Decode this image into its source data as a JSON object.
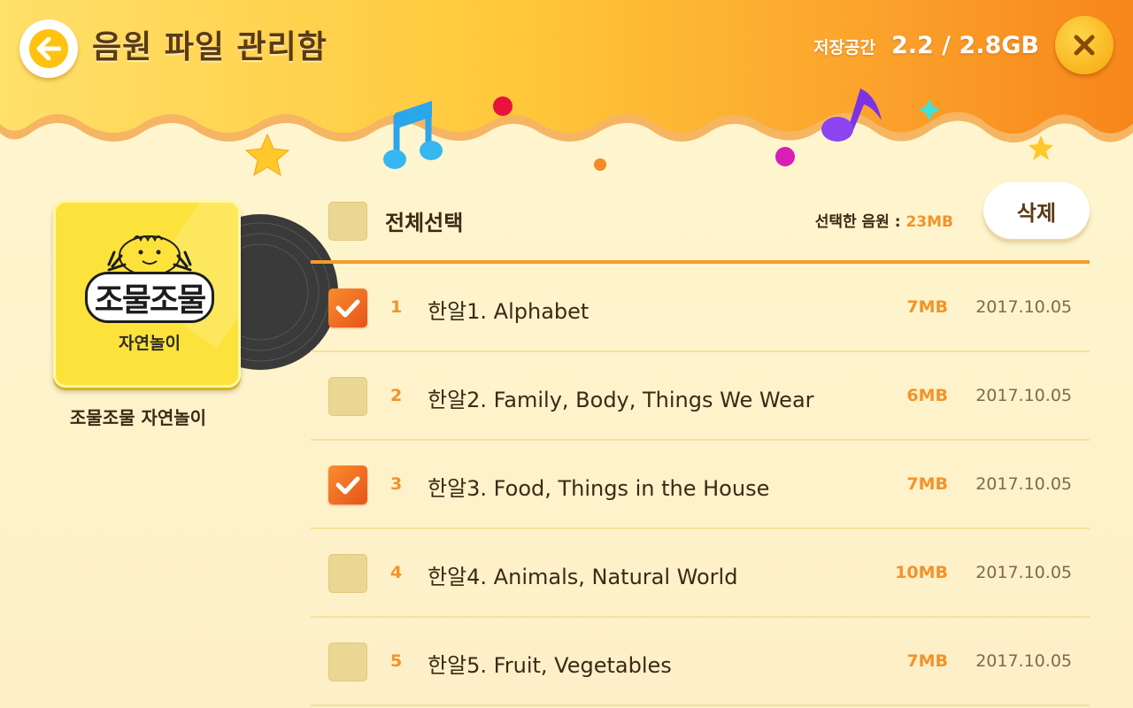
{
  "header": {
    "title": "음원 파일 관리함",
    "storage_label": "저장공간",
    "storage_value": "2.2 / 2.8GB"
  },
  "icons": {
    "back": "arrow-left-icon",
    "close": "close-icon",
    "check": "checkmark-icon"
  },
  "colors": {
    "accent": "#f3932a",
    "header_orange": "#f7931e",
    "header_yellow": "#ffd84e",
    "checked": "#e8531a"
  },
  "album": {
    "logo_title": "조물조물",
    "logo_sub": "자연놀이",
    "name": "조물조물 자연놀이"
  },
  "list": {
    "select_all_label": "전체선택",
    "selected_label": "선택한 음원 : ",
    "selected_value": "23MB",
    "delete_label": "삭제",
    "items": [
      {
        "num": "1",
        "title": "한알1. Alphabet",
        "size": "7MB",
        "date": "2017.10.05",
        "checked": true
      },
      {
        "num": "2",
        "title": "한알2. Family, Body, Things We Wear",
        "size": "6MB",
        "date": "2017.10.05",
        "checked": false
      },
      {
        "num": "3",
        "title": "한알3. Food, Things in the House",
        "size": "7MB",
        "date": "2017.10.05",
        "checked": true
      },
      {
        "num": "4",
        "title": "한알4. Animals, Natural World",
        "size": "10MB",
        "date": "2017.10.05",
        "checked": false
      },
      {
        "num": "5",
        "title": "한알5. Fruit, Vegetables",
        "size": "7MB",
        "date": "2017.10.05",
        "checked": false
      }
    ]
  }
}
